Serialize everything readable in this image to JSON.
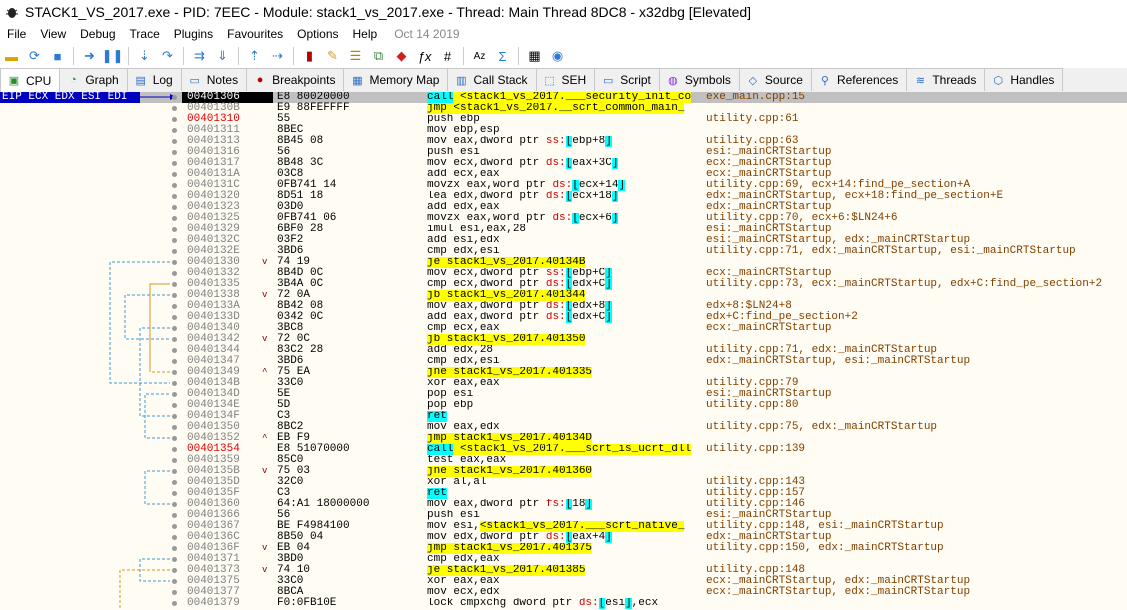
{
  "window": {
    "title": "STACK1_VS_2017.exe - PID: 7EEC - Module: stack1_vs_2017.exe - Thread: Main Thread 8DC8 - x32dbg [Elevated]"
  },
  "menu": [
    "File",
    "View",
    "Debug",
    "Trace",
    "Plugins",
    "Favourites",
    "Options",
    "Help"
  ],
  "build_date": "Oct 14 2019",
  "tabs": [
    {
      "label": "CPU",
      "icon": "cpu-icon",
      "active": true
    },
    {
      "label": "Graph",
      "icon": "graph-icon"
    },
    {
      "label": "Log",
      "icon": "log-icon"
    },
    {
      "label": "Notes",
      "icon": "notes-icon"
    },
    {
      "label": "Breakpoints",
      "icon": "breakpoint-icon"
    },
    {
      "label": "Memory Map",
      "icon": "memory-icon"
    },
    {
      "label": "Call Stack",
      "icon": "callstack-icon"
    },
    {
      "label": "SEH",
      "icon": "seh-icon"
    },
    {
      "label": "Script",
      "icon": "script-icon"
    },
    {
      "label": "Symbols",
      "icon": "symbols-icon"
    },
    {
      "label": "Source",
      "icon": "source-icon"
    },
    {
      "label": "References",
      "icon": "references-icon"
    },
    {
      "label": "Threads",
      "icon": "threads-icon"
    },
    {
      "label": "Handles",
      "icon": "handles-icon"
    }
  ],
  "eip_label": "EIP ECX EDX ESI EDI",
  "rows": [
    {
      "addr": "00401306",
      "bytes": "E8 80020000",
      "asm": "call <stack1_vs_2017.___security_init_co",
      "hl": "call",
      "cmt": "exe_main.cpp:15"
    },
    {
      "addr": "0040130B",
      "bytes": "E9 88FEFFFF",
      "asm": "jmp <stack1_vs_2017.__scrt_common_main_",
      "hl": "jmp",
      "cmt": ""
    },
    {
      "addr": "00401310",
      "bytes": "55",
      "asm": "push ebp",
      "cmt": "utility.cpp:61",
      "red": true
    },
    {
      "addr": "00401311",
      "bytes": "8BEC",
      "asm": "mov ebp,esp",
      "cmt": ""
    },
    {
      "addr": "00401313",
      "bytes": "8B45 08",
      "asm": "mov eax,dword ptr ss:[ebp+8]",
      "cmt": "utility.cpp:63"
    },
    {
      "addr": "00401316",
      "bytes": "56",
      "asm": "push esi",
      "cmt": "esi:_mainCRTStartup"
    },
    {
      "addr": "00401317",
      "bytes": "8B48 3C",
      "asm": "mov ecx,dword ptr ds:[eax+3C]",
      "cmt": "ecx:_mainCRTStartup"
    },
    {
      "addr": "0040131A",
      "bytes": "03C8",
      "asm": "add ecx,eax",
      "cmt": "ecx:_mainCRTStartup"
    },
    {
      "addr": "0040131C",
      "bytes": "0FB741 14",
      "asm": "movzx eax,word ptr ds:[ecx+14]",
      "cmt": "utility.cpp:69, ecx+14:find_pe_section+A"
    },
    {
      "addr": "00401320",
      "bytes": "8D51 18",
      "asm": "lea edx,dword ptr ds:[ecx+18]",
      "cmt": "edx:_mainCRTStartup, ecx+18:find_pe_section+E"
    },
    {
      "addr": "00401323",
      "bytes": "03D0",
      "asm": "add edx,eax",
      "cmt": "edx:_mainCRTStartup"
    },
    {
      "addr": "00401325",
      "bytes": "0FB741 06",
      "asm": "movzx eax,word ptr ds:[ecx+6]",
      "cmt": "utility.cpp:70, ecx+6:$LN24+6"
    },
    {
      "addr": "00401329",
      "bytes": "6BF0 28",
      "asm": "imul esi,eax,28",
      "cmt": "esi:_mainCRTStartup"
    },
    {
      "addr": "0040132C",
      "bytes": "03F2",
      "asm": "add esi,edx",
      "cmt": "esi:_mainCRTStartup, edx:_mainCRTStartup"
    },
    {
      "addr": "0040132E",
      "bytes": "3BD6",
      "asm": "cmp edx,esi",
      "cmt": "utility.cpp:71, edx:_mainCRTStartup, esi:_mainCRTStartup"
    },
    {
      "addr": "00401330",
      "bytes": "74 19",
      "asm": "je stack1_vs_2017.40134B",
      "hl": "jmp",
      "cmt": "",
      "jm": "v"
    },
    {
      "addr": "00401332",
      "bytes": "8B4D 0C",
      "asm": "mov ecx,dword ptr ss:[ebp+C]",
      "cmt": "ecx:_mainCRTStartup"
    },
    {
      "addr": "00401335",
      "bytes": "3B4A 0C",
      "asm": "cmp ecx,dword ptr ds:[edx+C]",
      "cmt": "utility.cpp:73, ecx:_mainCRTStartup, edx+C:find_pe_section+2"
    },
    {
      "addr": "00401338",
      "bytes": "72 0A",
      "asm": "jb stack1_vs_2017.401344",
      "hl": "jmp",
      "cmt": "",
      "jm": "v"
    },
    {
      "addr": "0040133A",
      "bytes": "8B42 08",
      "asm": "mov eax,dword ptr ds:[edx+8]",
      "cmt": "edx+8:$LN24+8"
    },
    {
      "addr": "0040133D",
      "bytes": "0342 0C",
      "asm": "add eax,dword ptr ds:[edx+C]",
      "cmt": "edx+C:find_pe_section+2"
    },
    {
      "addr": "00401340",
      "bytes": "3BC8",
      "asm": "cmp ecx,eax",
      "cmt": "ecx:_mainCRTStartup"
    },
    {
      "addr": "00401342",
      "bytes": "72 0C",
      "asm": "jb stack1_vs_2017.401350",
      "hl": "jmp",
      "cmt": "",
      "jm": "v"
    },
    {
      "addr": "00401344",
      "bytes": "83C2 28",
      "asm": "add edx,28",
      "cmt": "utility.cpp:71, edx:_mainCRTStartup"
    },
    {
      "addr": "00401347",
      "bytes": "3BD6",
      "asm": "cmp edx,esi",
      "cmt": "edx:_mainCRTStartup, esi:_mainCRTStartup"
    },
    {
      "addr": "00401349",
      "bytes": "75 EA",
      "asm": "jne stack1_vs_2017.401335",
      "hl": "jmp",
      "cmt": "",
      "jm": "^"
    },
    {
      "addr": "0040134B",
      "bytes": "33C0",
      "asm": "xor eax,eax",
      "cmt": "utility.cpp:79"
    },
    {
      "addr": "0040134D",
      "bytes": "5E",
      "asm": "pop esi",
      "cmt": "esi:_mainCRTStartup"
    },
    {
      "addr": "0040134E",
      "bytes": "5D",
      "asm": "pop ebp",
      "cmt": "utility.cpp:80"
    },
    {
      "addr": "0040134F",
      "bytes": "C3",
      "asm": "ret",
      "hl": "ret",
      "cmt": ""
    },
    {
      "addr": "00401350",
      "bytes": "8BC2",
      "asm": "mov eax,edx",
      "cmt": "utility.cpp:75, edx:_mainCRTStartup"
    },
    {
      "addr": "00401352",
      "bytes": "EB F9",
      "asm": "jmp stack1_vs_2017.40134D",
      "hl": "jmp",
      "cmt": "",
      "jm": "^"
    },
    {
      "addr": "00401354",
      "bytes": "E8 51070000",
      "asm": "call <stack1_vs_2017.___scrt_is_ucrt_dll",
      "hl": "call",
      "cmt": "utility.cpp:139",
      "red": true
    },
    {
      "addr": "00401359",
      "bytes": "85C0",
      "asm": "test eax,eax",
      "cmt": ""
    },
    {
      "addr": "0040135B",
      "bytes": "75 03",
      "asm": "jne stack1_vs_2017.401360",
      "hl": "jmp",
      "cmt": "",
      "jm": "v"
    },
    {
      "addr": "0040135D",
      "bytes": "32C0",
      "asm": "xor al,al",
      "cmt": "utility.cpp:143"
    },
    {
      "addr": "0040135F",
      "bytes": "C3",
      "asm": "ret",
      "hl": "ret",
      "cmt": "utility.cpp:157"
    },
    {
      "addr": "00401360",
      "bytes": "64:A1 18000000",
      "asm": "mov eax,dword ptr fs:[18]",
      "cmt": "utility.cpp:146"
    },
    {
      "addr": "00401366",
      "bytes": "56",
      "asm": "push esi",
      "cmt": "esi:_mainCRTStartup"
    },
    {
      "addr": "00401367",
      "bytes": "BE F4984100",
      "asm": "mov esi,<stack1_vs_2017.___scrt_native_",
      "cmt": "utility.cpp:148, esi:_mainCRTStartup"
    },
    {
      "addr": "0040136C",
      "bytes": "8B50 04",
      "asm": "mov edx,dword ptr ds:[eax+4]",
      "cmt": "edx:_mainCRTStartup"
    },
    {
      "addr": "0040136F",
      "bytes": "EB 04",
      "asm": "jmp stack1_vs_2017.401375",
      "hl": "jmp",
      "cmt": "utility.cpp:150, edx:_mainCRTStartup",
      "jm": "v"
    },
    {
      "addr": "00401371",
      "bytes": "3BD0",
      "asm": "cmp edx,eax",
      "cmt": ""
    },
    {
      "addr": "00401373",
      "bytes": "74 10",
      "asm": "je stack1_vs_2017.401385",
      "hl": "jmp",
      "cmt": "utility.cpp:148",
      "jm": "v"
    },
    {
      "addr": "00401375",
      "bytes": "33C0",
      "asm": "xor eax,eax",
      "cmt": "ecx:_mainCRTStartup, edx:_mainCRTStartup"
    },
    {
      "addr": "00401377",
      "bytes": "8BCA",
      "asm": "mov ecx,edx",
      "cmt": "ecx:_mainCRTStartup, edx:_mainCRTStartup"
    },
    {
      "addr": "00401379",
      "bytes": "F0:0FB10E",
      "asm": "lock cmpxchg dword ptr ds:[esi],ecx",
      "cmt": ""
    }
  ]
}
